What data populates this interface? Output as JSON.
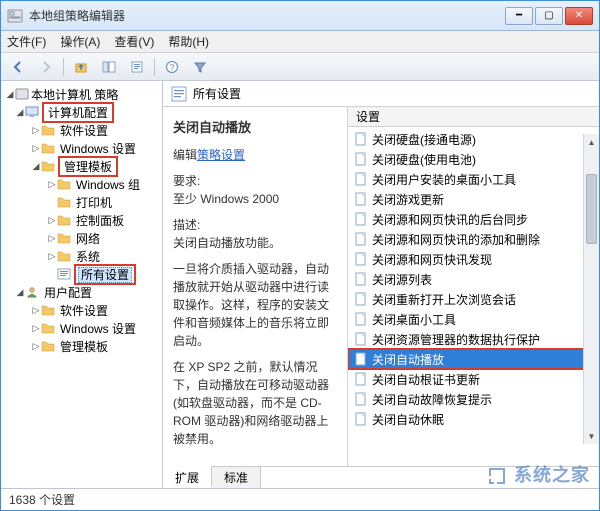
{
  "window": {
    "title": "本地组策略编辑器"
  },
  "menubar": {
    "file": "文件(F)",
    "action": "操作(A)",
    "view": "查看(V)",
    "help": "帮助(H)"
  },
  "tree": {
    "root": "本地计算机 策略",
    "computer_config": "计算机配置",
    "software_settings": "软件设置",
    "windows_settings": "Windows 设置",
    "admin_templates": "管理模板",
    "windows_group": "Windows 组",
    "printers": "打印机",
    "control_panel": "控制面板",
    "network": "网络",
    "system": "系统",
    "all_settings": "所有设置",
    "user_config": "用户配置",
    "u_software_settings": "软件设置",
    "u_windows_settings": "Windows 设置",
    "u_admin_templates": "管理模板"
  },
  "content": {
    "header": "所有设置",
    "title": "关闭自动播放",
    "edit_prefix": "编辑",
    "edit_link": "策略设置",
    "req_label": "要求:",
    "req_value": "至少 Windows 2000",
    "desc_label": "描述:",
    "desc_value": "关闭自动播放功能。",
    "para1": "一旦将介质插入驱动器，自动播放就开始从驱动器中进行读取操作。这样，程序的安装文件和音频媒体上的音乐将立即启动。",
    "para2": "在 XP SP2 之前，默认情况下，自动播放在可移动驱动器(如软盘驱动器，而不是 CD-ROM 驱动器)和网络驱动器上被禁用。"
  },
  "list": {
    "header": "设置",
    "items": [
      "关闭硬盘(接通电源)",
      "关闭硬盘(使用电池)",
      "关闭用户安装的桌面小工具",
      "关闭游戏更新",
      "关闭源和网页快讯的后台同步",
      "关闭源和网页快讯的添加和删除",
      "关闭源和网页快讯发现",
      "关闭源列表",
      "关闭重新打开上次浏览会话",
      "关闭桌面小工具",
      "关闭资源管理器的数据执行保护",
      "关闭自动播放",
      "关闭自动根证书更新",
      "关闭自动故障恢复提示",
      "关闭自动休眠"
    ],
    "selected_index": 11
  },
  "tabs": {
    "extended": "扩展",
    "standard": "标准"
  },
  "statusbar": {
    "text": "1638 个设置"
  },
  "watermark": "系统之家"
}
